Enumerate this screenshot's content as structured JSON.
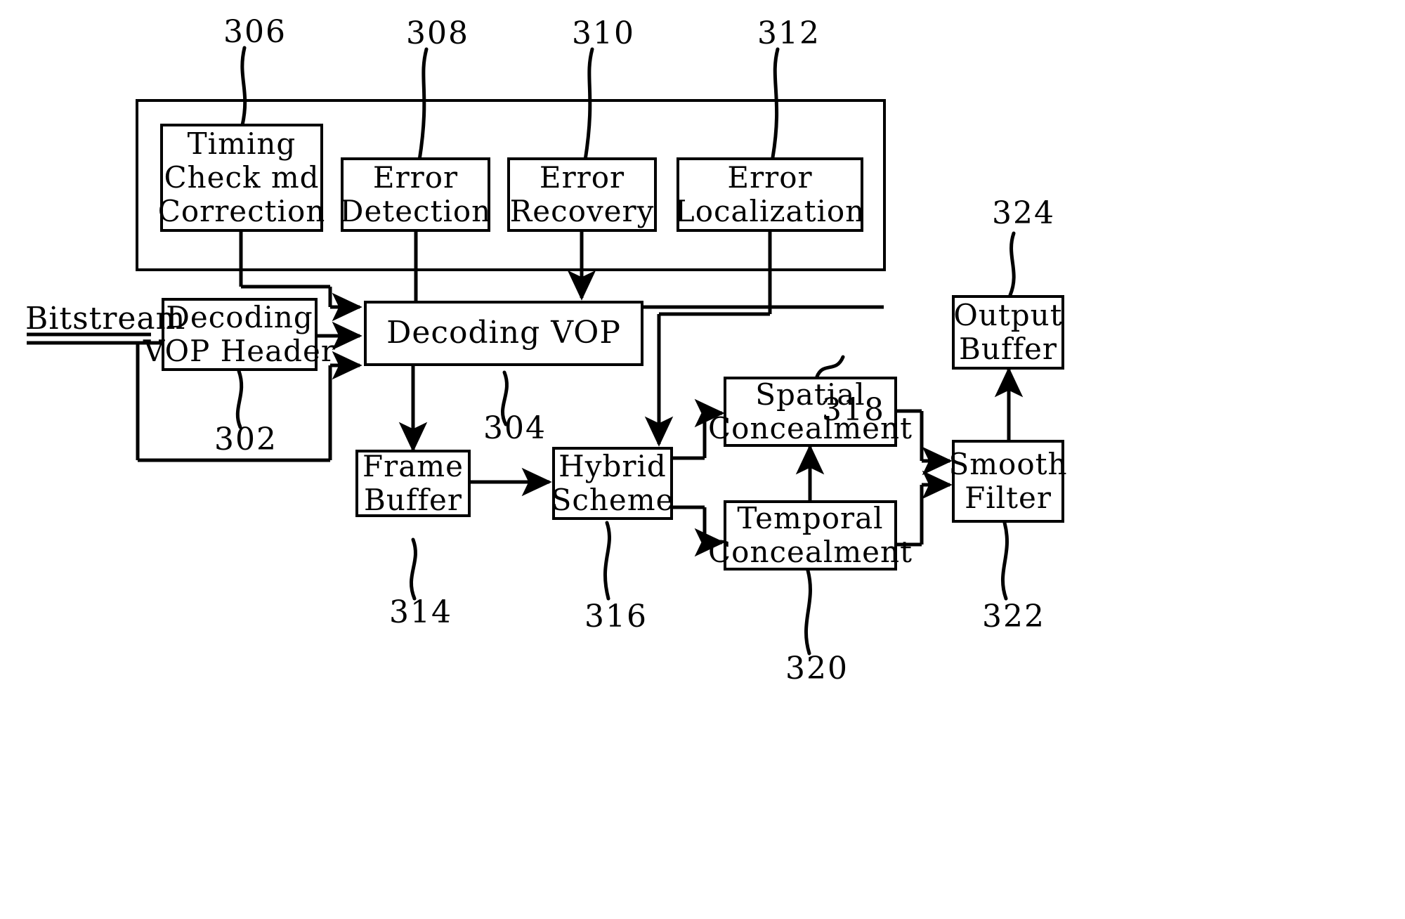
{
  "figure": {
    "type": "patent-block-diagram",
    "background": "#ffffff",
    "ink_color": "#000000"
  },
  "labels": {
    "bitstream": "Bitstream"
  },
  "blocks": {
    "timing_check": {
      "line1": "Timing",
      "line2": "Check md",
      "line3": "Correction"
    },
    "error_detection": {
      "line1": "Error",
      "line2": "Detection"
    },
    "error_recovery": {
      "line1": "Error",
      "line2": "Recovery"
    },
    "error_localization": {
      "line1": "Error",
      "line2": "Localization"
    },
    "decoding_vop_header": {
      "line1": "Decoding",
      "line2": "VOP Header"
    },
    "decoding_vop": {
      "line1": "Decoding VOP"
    },
    "frame_buffer": {
      "line1": "Frame",
      "line2": "Buffer"
    },
    "hybrid_scheme": {
      "line1": "Hybrid",
      "line2": "Scheme"
    },
    "spatial_concealment": {
      "line1": "Spatial",
      "line2": "Concealment"
    },
    "temporal_concealment": {
      "line1": "Temporal",
      "line2": "Concealment"
    },
    "smooth_filter": {
      "line1": "Smooth",
      "line2": "Filter"
    },
    "output_buffer": {
      "line1": "Output",
      "line2": "Buffer"
    }
  },
  "reference_numerals": {
    "n302": "302",
    "n304": "304",
    "n306": "306",
    "n308": "308",
    "n310": "310",
    "n312": "312",
    "n314": "314",
    "n316": "316",
    "n318": "318",
    "n320": "320",
    "n322": "322",
    "n324": "324"
  }
}
